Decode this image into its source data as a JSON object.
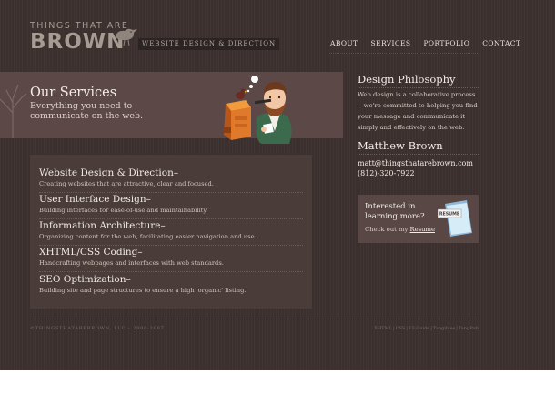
{
  "header": {
    "logo_top": "THINGS THAT ARE",
    "logo_main": "BROWN",
    "tagline": "WEBSITE DESIGN & DIRECTION",
    "nav": [
      "ABOUT",
      "SERVICES",
      "PORTFOLIO",
      "CONTACT"
    ]
  },
  "banner": {
    "title": "Our Services",
    "subtitle": "Everything you need to communicate on the web."
  },
  "services": [
    {
      "title": "Website Design & Direction–",
      "desc": "Creating websites that are attractive, clear and focused."
    },
    {
      "title": "User Interface Design–",
      "desc": "Building interfaces for ease-of-use and maintainability."
    },
    {
      "title": "Information Architecture–",
      "desc": "Organizing content for the web, facilitating easier navigation and use."
    },
    {
      "title": "XHTML/CSS Coding–",
      "desc": "Handcrafting webpages and interfaces with web standards."
    },
    {
      "title": "SEO Optimization–",
      "desc": "Building site and page structures to ensure a high 'organic' listing."
    }
  ],
  "sidebar": {
    "philosophy_title": "Design Philosophy",
    "philosophy_text": "Web design is a collaborative process—we're committed to helping you find your message and communicate it simply and effectively on the web.",
    "contact_name": "Matthew Brown",
    "email": "matt@thingsthatarebrown.com",
    "phone": "(812)-320-7922",
    "resume_heading": "Interested in learning more?",
    "resume_check": "Check out my ",
    "resume_link": "Resume",
    "resume_doc_label": "RESUME"
  },
  "footer": {
    "copyright": "©THINGSTHATAREBROWN, LLC – 2000-2007",
    "links": [
      "XHTML",
      "CSS",
      "F3 Guide",
      "Tangibles",
      "TangPub"
    ]
  },
  "colors": {
    "background": "#3b302d",
    "banner": "#5c4846",
    "panel": "#4a3c39",
    "accent_orange": "#e07a2a"
  }
}
